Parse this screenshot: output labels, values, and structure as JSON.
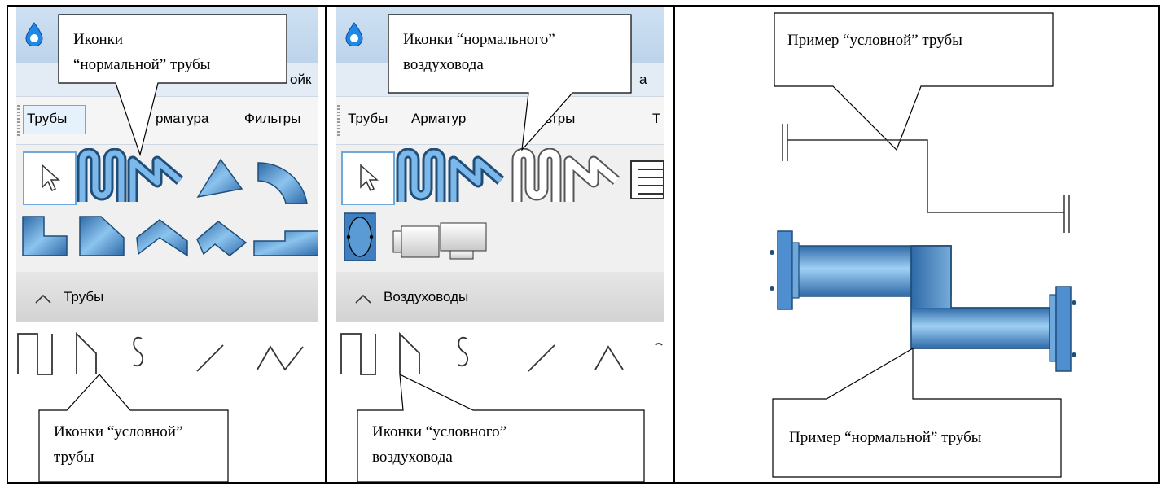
{
  "panel1": {
    "callout_top": [
      "Иконки",
      "“нормальной” трубы"
    ],
    "menu_tail": "ойк",
    "toolbar": [
      "Трубы",
      "рматура",
      "Фильтры"
    ],
    "section_label": "Трубы",
    "callout_bottom": [
      "Иконки “условной”",
      "трубы"
    ]
  },
  "panel2": {
    "callout_top": [
      "Иконки “нормального”",
      "воздуховода"
    ],
    "menu_tail": "а",
    "toolbar": [
      "Трубы",
      "Арматур",
      "ильтры",
      "Т"
    ],
    "section_label": "Воздуховоды",
    "callout_bottom": [
      "Иконки “условного”",
      "воздуховода"
    ]
  },
  "panel3": {
    "callout_top": "Пример “условной” трубы",
    "callout_bottom": "Пример “нормальной” трубы"
  },
  "colors": {
    "pipe_blue": "#5a9bd5",
    "pipe_dark": "#1f4e79",
    "panel_bg": "#f0f0f0",
    "section_bg": "#dcdcdc",
    "selection": "#6fa8dc"
  }
}
